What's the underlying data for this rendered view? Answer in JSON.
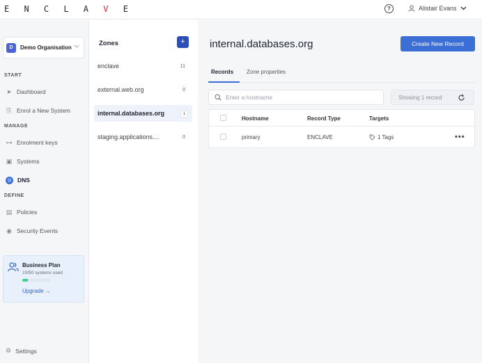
{
  "app": {
    "logo_prefix": "E N C L A ",
    "logo_accent": "V",
    "logo_suffix": " E"
  },
  "header": {
    "help": "?",
    "user_name": "Alistair Evans"
  },
  "sidebar": {
    "org": {
      "badge": "D",
      "label": "Demo Organisation"
    },
    "sections": {
      "start": "START",
      "manage": "MANAGE",
      "define": "DEFINE"
    },
    "items": {
      "dashboard": "Dashboard",
      "enrol": "Enrol a New System",
      "enrolment_keys": "Enrolment keys",
      "systems": "Systems",
      "dns": "DNS",
      "policies": "Policies",
      "security_events": "Security Events"
    },
    "plan": {
      "title": "Business Plan",
      "usage": "10/50 systems used",
      "usage_fraction": 0.2,
      "upgrade": "Upgrade →"
    },
    "settings": "Settings"
  },
  "zones": {
    "title": "Zones",
    "add": "+",
    "items": [
      {
        "name": "enclave",
        "count": "11"
      },
      {
        "name": "external.web.org",
        "count": "0"
      },
      {
        "name": "internal.databases.org",
        "count": "1"
      },
      {
        "name": "staging.applications....",
        "count": "0"
      }
    ]
  },
  "main": {
    "title": "internal.databases.org",
    "create_button": "Create New Record",
    "tabs": {
      "records": "Records",
      "zone_properties": "Zone properties"
    },
    "search_placeholder": "Enter a hostname",
    "showing": "Showing 1 record",
    "table": {
      "headers": {
        "hostname": "Hostname",
        "record_type": "Record Type",
        "targets": "Targets"
      },
      "rows": [
        {
          "hostname": "primary",
          "record_type": "ENCLAVE",
          "targets": "1 Tags"
        }
      ]
    }
  },
  "colors": {
    "accent": "#3c6fd6",
    "logo_red": "#d9232e",
    "progress": "#3fd38d"
  }
}
